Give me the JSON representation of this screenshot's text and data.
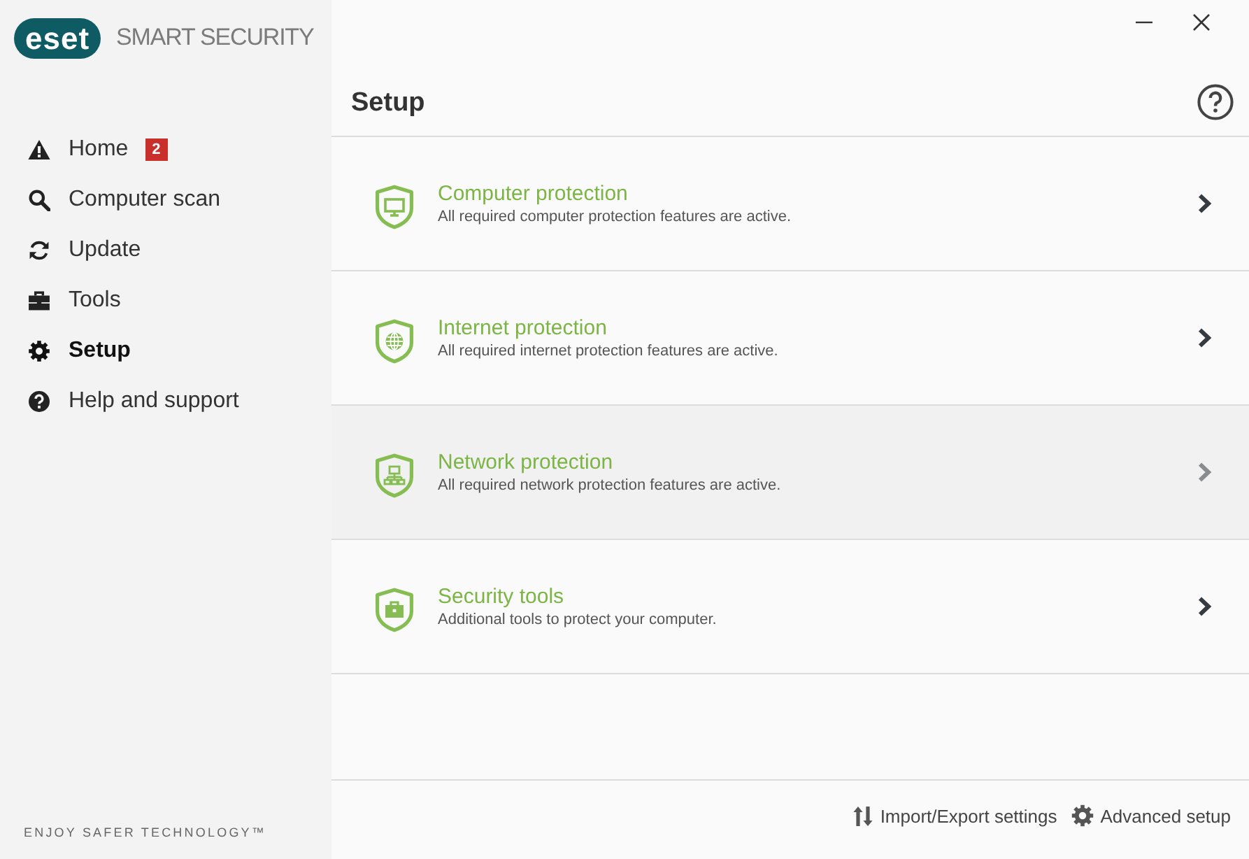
{
  "logo": {
    "brand": "eset",
    "product": "SMART SECURITY"
  },
  "sidebar": {
    "items": [
      {
        "label": "Home",
        "badge": "2",
        "selected": false
      },
      {
        "label": "Computer scan",
        "selected": false
      },
      {
        "label": "Update",
        "selected": false
      },
      {
        "label": "Tools",
        "selected": false
      },
      {
        "label": "Setup",
        "selected": true
      },
      {
        "label": "Help and support",
        "selected": false
      }
    ],
    "tagline": "ENJOY SAFER TECHNOLOGY™"
  },
  "main": {
    "title": "Setup",
    "sections": [
      {
        "title": "Computer protection",
        "description": "All required computer protection features are active.",
        "highlighted": false
      },
      {
        "title": "Internet protection",
        "description": "All required internet protection features are active.",
        "highlighted": false
      },
      {
        "title": "Network protection",
        "description": "All required network protection features are active.",
        "highlighted": true
      },
      {
        "title": "Security tools",
        "description": "Additional tools to protect your computer.",
        "highlighted": false
      }
    ]
  },
  "footer": {
    "actions": [
      {
        "label": "Import/Export settings"
      },
      {
        "label": "Advanced setup"
      }
    ]
  }
}
